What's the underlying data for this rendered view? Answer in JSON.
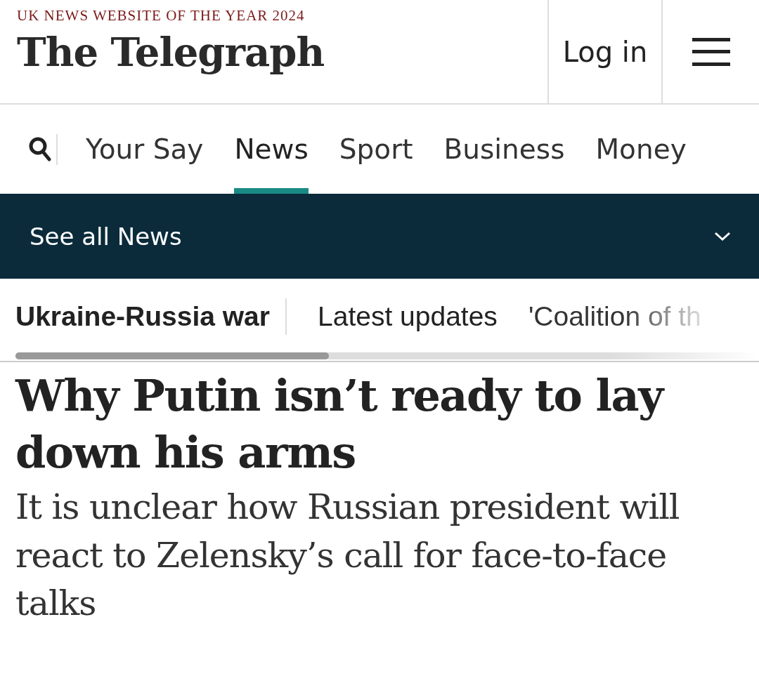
{
  "header": {
    "tagline": "UK NEWS WEBSITE OF THE YEAR 2024",
    "logo": "The Telegraph",
    "login": "Log in"
  },
  "nav": {
    "items": [
      {
        "label": "Your Say",
        "selected": false
      },
      {
        "label": "News",
        "selected": true
      },
      {
        "label": "Sport",
        "selected": false
      },
      {
        "label": "Business",
        "selected": false
      },
      {
        "label": "Money",
        "selected": false
      }
    ]
  },
  "section_bar": {
    "label": "See all News",
    "expanded": false
  },
  "topics": {
    "current": "Ukraine-Russia war",
    "items": [
      "Latest updates",
      "'Coalition of th"
    ]
  },
  "article": {
    "headline": "Why Putin isn’t ready to lay down his arms",
    "standfirst": "It is unclear how Russian president will react to Zelensky’s call for face-to-face talks"
  }
}
